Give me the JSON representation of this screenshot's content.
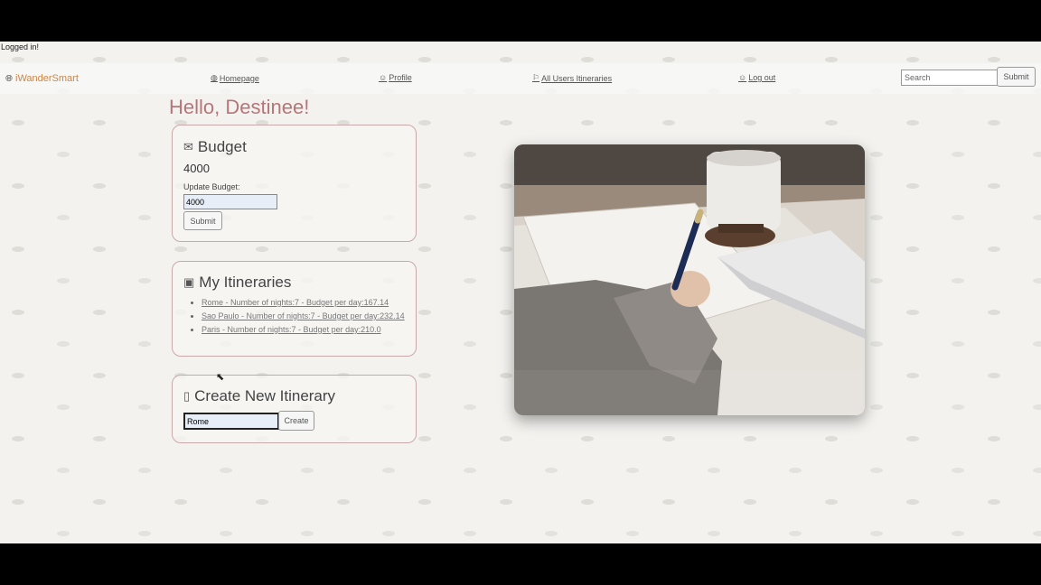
{
  "flash": "Logged in!",
  "nav": {
    "brand": "iWanderSmart",
    "links": [
      {
        "label": "Homepage",
        "icon": "globe-icon"
      },
      {
        "label": "Profile",
        "icon": "smiley-icon"
      },
      {
        "label": "All Users Itineraries",
        "icon": "signpost-icon"
      },
      {
        "label": "Log out",
        "icon": "smiley-icon"
      }
    ],
    "search_placeholder": "Search",
    "search_button": "Submit"
  },
  "greeting": "Hello, Destinee!",
  "budget": {
    "title": "Budget",
    "value": "4000",
    "update_label": "Update Budget:",
    "input_value": "4000",
    "submit": "Submit"
  },
  "itineraries": {
    "title": "My Itineraries",
    "items": [
      "Rome - Number of nights:7 - Budget per day:167.14",
      "Sao Paulo - Number of nights:7 - Budget per day:232.14",
      "Paris - Number of nights:7 - Budget per day:210.0"
    ]
  },
  "create": {
    "title": "Create New Itinerary",
    "input_value": "Rome",
    "button": "Create"
  },
  "colors": {
    "accent": "#c8874a",
    "greeting": "#b5767a",
    "card_border": "#c9a8aa"
  }
}
